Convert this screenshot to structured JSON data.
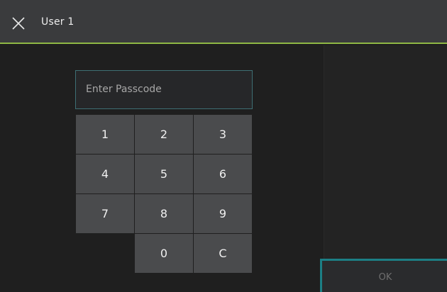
{
  "header": {
    "title": "User 1",
    "close_icon": "close-icon"
  },
  "passcode": {
    "placeholder": "Enter Passcode",
    "value": ""
  },
  "keypad": {
    "keys": [
      "1",
      "2",
      "3",
      "4",
      "5",
      "6",
      "7",
      "8",
      "9",
      "0",
      "C"
    ]
  },
  "actions": {
    "ok_label": "OK",
    "ok_enabled": false
  },
  "colors": {
    "header_bg": "#3a3b3d",
    "accent_line": "#8fb845",
    "field_border": "#3e6f74",
    "key_bg": "#4a4b4d",
    "ok_border": "#1c7f85",
    "background": "#1f1f1f"
  }
}
